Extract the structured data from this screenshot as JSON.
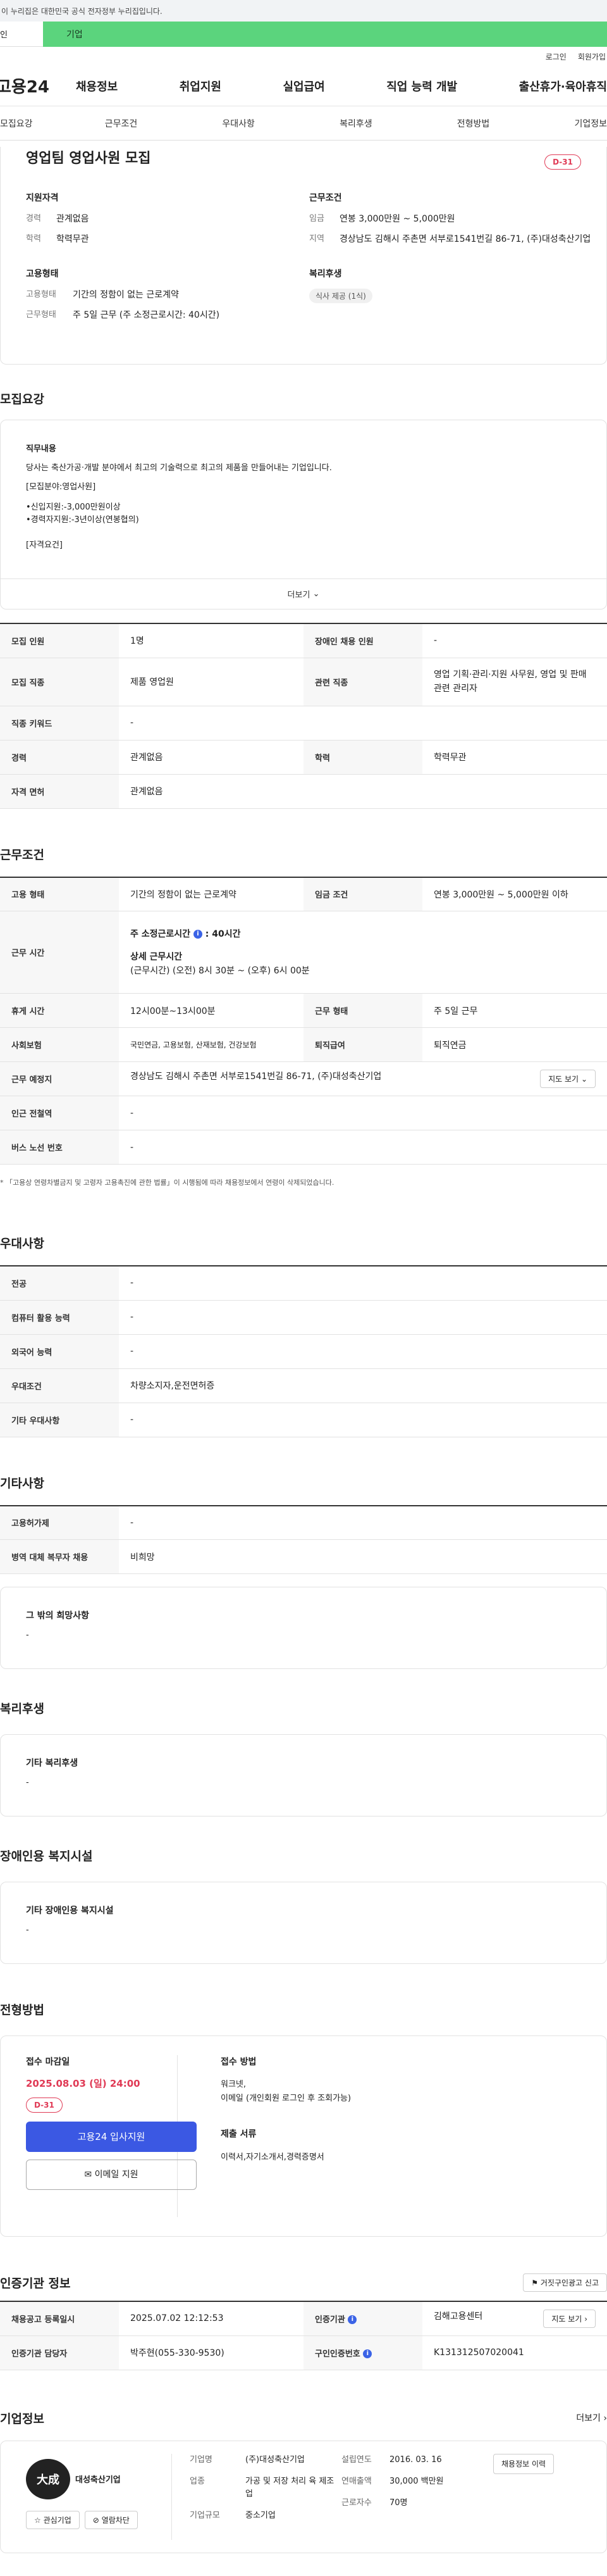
{
  "gov_banner": "이 누리집은 대한민국 공식 전자정부 누리집입니다.",
  "tabs": {
    "left": "인",
    "right": "기업"
  },
  "util": {
    "login": "로그인",
    "join": "회원가입"
  },
  "logo": "고용24",
  "gnb": [
    "채용정보",
    "취업지원",
    "실업급여",
    "직업 능력 개발",
    "출산휴가·육아휴직"
  ],
  "anchors": [
    "모집요강",
    "근무조건",
    "우대사항",
    "복리후생",
    "전형방법",
    "기업정보"
  ],
  "summary": {
    "title": "영업팀 영업사원 모집",
    "dday": "D-31",
    "qual_title": "지원자격",
    "qual": [
      {
        "k": "경력",
        "v": "관계없음"
      },
      {
        "k": "학력",
        "v": "학력무관"
      }
    ],
    "cond_title": "근무조건",
    "cond": [
      {
        "k": "임금",
        "v": "연봉 3,000만원 ~ 5,000만원"
      },
      {
        "k": "지역",
        "v": "경상남도 김해시 주촌면 서부로1541번길 86-71, (주)대성축산기업"
      }
    ],
    "emp_title": "고용형태",
    "emp": [
      {
        "k": "고용형태",
        "v": "기간의 정함이 없는 근로계약"
      },
      {
        "k": "근무형태",
        "v": "주 5일 근무 (주 소정근로시간: 40시간)"
      }
    ],
    "welfare_title": "복리후생",
    "welfare_chip": "식사 제공 (1식)"
  },
  "recruit": {
    "title": "모집요강",
    "duty_title": "직무내용",
    "duty_lines": [
      "당사는 축산가공·개발 분야에서 최고의 기술력으로 최고의 제품을 만들어내는 기업입니다.",
      "[모집분야:영업사원]",
      "•신입지원:-3,000만원이상",
      "•경력자지원:-3년이상(연봉협의)",
      "[자격요건]"
    ],
    "more": "더보기",
    "rows": [
      {
        "h1": "모집 인원",
        "v1": "1명",
        "h2": "장애인 채용 인원",
        "v2": "-"
      },
      {
        "h1": "모집 직종",
        "v1": "제품 영업원",
        "h2": "관련 직종",
        "v2": "영업 기획·관리·지원 사무원, 영업 및 판매 관련 관리자"
      },
      {
        "h1": "직종 키워드",
        "v1": "-"
      },
      {
        "h1": "경력",
        "v1": "관계없음",
        "h2": "학력",
        "v2": "학력무관"
      },
      {
        "h1": "자격 면허",
        "v1": "관계없음"
      }
    ]
  },
  "work": {
    "title": "근무조건",
    "type_h": "고용 형태",
    "type_v": "기간의 정함이 없는 근로계약",
    "wage_h": "임금 조건",
    "wage_v": "연봉 3,000만원 ~ 5,000만원 이하",
    "time_h": "근무 시간",
    "time_l1": "주 소정근로시간",
    "time_l1v": "40시간",
    "time_l2": "상세 근무시간",
    "time_l3": "(근무시간) (오전) 8시 30분 ~ (오후) 6시 00분",
    "rest_h": "휴게 시간",
    "rest_v": "12시00분~13시00분",
    "form_h": "근무 형태",
    "form_v": "주 5일 근무",
    "ins_h": "사회보험",
    "ins_v": "국민연금, 고용보험, 산재보험, 건강보험",
    "ret_h": "퇴직급여",
    "ret_v": "퇴직연금",
    "place_h": "근무 예정지",
    "place_v": "경상남도 김해시 주촌면 서부로1541번길 86-71, (주)대성축산기업",
    "map_btn": "지도 보기",
    "sub_h": "인근 전철역",
    "sub_v": "-",
    "bus_h": "버스 노선 번호",
    "bus_v": "-",
    "note": "* 「고용상 연령차별금지 및 고령자 고용촉진에 관한 법률」이 시행됨에 따라 채용정보에서 연령이 삭제되었습니다."
  },
  "pref": {
    "title": "우대사항",
    "rows": [
      {
        "h": "전공",
        "v": "-"
      },
      {
        "h": "컴퓨터 활용 능력",
        "v": "-"
      },
      {
        "h": "외국어 능력",
        "v": "-"
      },
      {
        "h": "우대조건",
        "v": "차량소지자,운전면허증"
      },
      {
        "h": "기타 우대사항",
        "v": "-"
      }
    ]
  },
  "etc": {
    "title": "기타사항",
    "rows": [
      {
        "h": "고용허가제",
        "v": "-"
      },
      {
        "h": "병역 대체 복무자 채용",
        "v": "비희망"
      }
    ],
    "box_title": "그 밖의 희망사항",
    "box_v": "-"
  },
  "welfare": {
    "title": "복리후생",
    "box_title": "기타 복리후생",
    "box_v": "-"
  },
  "disabled": {
    "title": "장애인용 복지시설",
    "box_title": "기타 장애인용 복지시설",
    "box_v": "-"
  },
  "selection": {
    "title": "전형방법",
    "deadline_label": "접수 마감일",
    "deadline": "2025.08.03 (일) 24:00",
    "dday": "D-31",
    "apply_btn": "고용24 입사지원",
    "email_btn": "이메일 지원",
    "method_label": "접수 방법",
    "method_v1": "워크넷,",
    "method_v2": "이메일 (개인회원 로그인 후 조회가능)",
    "docs_label": "제출 서류",
    "docs_v": "이력서,자기소개서,경력증명서"
  },
  "agency": {
    "title": "인증기관 정보",
    "report_btn": "거짓구인광고 신고",
    "r1h1": "채용공고 등록일시",
    "r1v1": "2025.07.02 12:12:53",
    "r1h2": "인증기관",
    "r1v2": "김해고용센터",
    "r1btn": "지도 보기",
    "r2h1": "인증기관 담당자",
    "r2v1": "박주현(055-330-9530)",
    "r2h2": "구인인증번호",
    "r2v2": "K131312507020041"
  },
  "company": {
    "title": "기업정보",
    "more": "더보기",
    "logo_small": "대성축산기업",
    "fav_btn": "관심기업",
    "block_btn": "열람차단",
    "name_k": "기업명",
    "name_v": "(주)대성축산기업",
    "ind_k": "업종",
    "ind_v": "가공 및 저장 처리 육 제조업",
    "size_k": "기업규모",
    "size_v": "중소기업",
    "est_k": "설립연도",
    "est_v": "2016. 03. 16",
    "sales_k": "연매출액",
    "sales_v": "30,000 백만원",
    "emp_k": "근로자수",
    "emp_v": "70명",
    "hire_btn": "채용정보 이력"
  },
  "colors": {
    "accent": "#3b58e3",
    "dday": "#e03a55",
    "green": "#5bd47d"
  }
}
